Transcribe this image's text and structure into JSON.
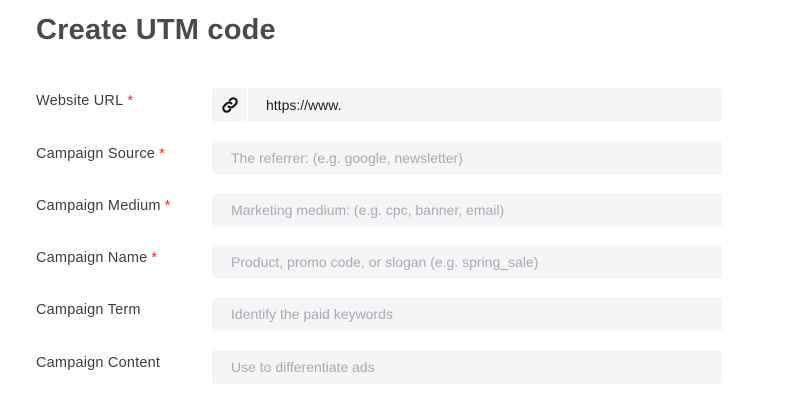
{
  "page": {
    "title": "Create UTM code"
  },
  "colors": {
    "required": "#e03131",
    "field_bg": "#f4f5f6"
  },
  "fields": [
    {
      "label": "Website URL",
      "required": "*",
      "value": "https://www.",
      "placeholder": "",
      "icon": "link-icon"
    },
    {
      "label": "Campaign Source",
      "required": "*",
      "value": "",
      "placeholder": "The referrer: (e.g. google, newsletter)"
    },
    {
      "label": "Campaign Medium",
      "required": "*",
      "value": "",
      "placeholder": "Marketing medium: (e.g. cpc, banner, email)"
    },
    {
      "label": "Campaign Name",
      "required": "*",
      "value": "",
      "placeholder": "Product, promo code, or slogan (e.g. spring_sale)"
    },
    {
      "label": "Campaign Term",
      "required": "",
      "value": "",
      "placeholder": "Identify the paid keywords"
    },
    {
      "label": "Campaign Content",
      "required": "",
      "value": "",
      "placeholder": "Use to differentiate ads"
    }
  ]
}
